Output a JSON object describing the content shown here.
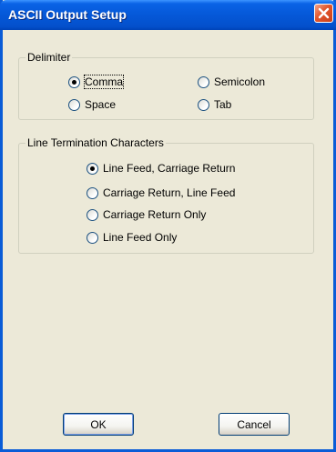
{
  "window": {
    "title": "ASCII Output Setup"
  },
  "delimiter": {
    "legend": "Delimiter",
    "options": [
      {
        "label": "Comma",
        "selected": true
      },
      {
        "label": "Semicolon",
        "selected": false
      },
      {
        "label": "Space",
        "selected": false
      },
      {
        "label": "Tab",
        "selected": false
      }
    ]
  },
  "line_termination": {
    "legend": "Line Termination Characters",
    "options": [
      {
        "label": "Line Feed, Carriage Return",
        "selected": true
      },
      {
        "label": "Carriage Return, Line Feed",
        "selected": false
      },
      {
        "label": "Carriage Return Only",
        "selected": false
      },
      {
        "label": "Line Feed Only",
        "selected": false
      }
    ]
  },
  "buttons": {
    "ok": "OK",
    "cancel": "Cancel"
  },
  "icons": {
    "close": "close-icon"
  }
}
